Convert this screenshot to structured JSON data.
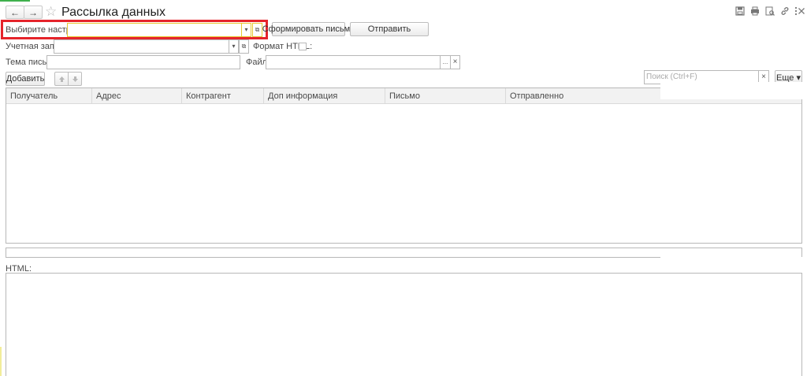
{
  "window": {
    "title": "Рассылка данных",
    "nav": {
      "back_icon": "←",
      "forward_icon": "→",
      "favorite_icon": "☆"
    },
    "toolbar_icons": [
      "save-icon",
      "print-icon",
      "preview-icon",
      "link-icon",
      "more-icon",
      "close-icon"
    ]
  },
  "settings": {
    "label": "Выбирите настройку:",
    "value": "",
    "dropdown_icon": "▾",
    "open_icon": "⧉"
  },
  "buttons": {
    "generate": "Сформировать письма",
    "send": "Отправить",
    "add": "Добавить",
    "more": "Еще ▾"
  },
  "account": {
    "label": "Учетная запись:",
    "value": ""
  },
  "html_format": {
    "label": "Формат HTML:",
    "checked": false
  },
  "subject": {
    "label": "Тема письма:",
    "value": ""
  },
  "file": {
    "label": "Файл:",
    "value": "",
    "browse": "...",
    "clear": "×"
  },
  "search": {
    "placeholder": "Поиск (Ctrl+F)",
    "clear": "×"
  },
  "table": {
    "columns": [
      "Получатель",
      "Адрес",
      "Контрагент",
      "Доп информация",
      "Письмо",
      "Отправленно"
    ],
    "rows": []
  },
  "html_section": {
    "label": "HTML:"
  }
}
